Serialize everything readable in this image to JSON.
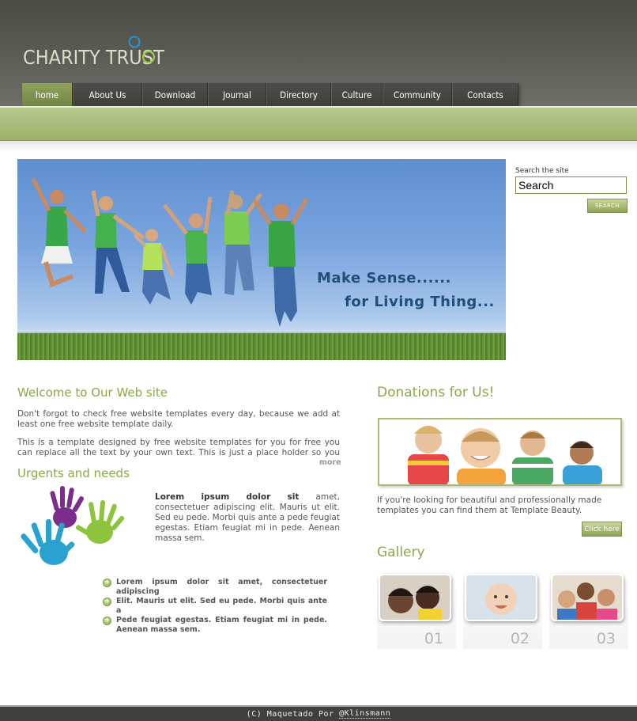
{
  "site": {
    "logo_text": "CHARITY TRUST"
  },
  "nav": {
    "items": [
      "home",
      "About Us",
      "Download",
      "Journal",
      "Directory",
      "Culture",
      "Community",
      "Contacts"
    ],
    "active": "home"
  },
  "banner": {
    "line1": "Make Sense......",
    "line2": "for Living Thing..."
  },
  "search": {
    "label": "Search the site",
    "value": "Search",
    "button": "SEARCH"
  },
  "welcome": {
    "title": "Welcome to Our Web site",
    "p1": "Don't forgot to check free website templates every day, because we add at least one free website template daily.",
    "p2": "This is a template designed by free website templates for you for free you can replace all the text by your own text. This is just a place holder so you can see how",
    "more": "more"
  },
  "urgents": {
    "title": "Urgents and needs",
    "lorem_bold": "Lorem ipsum dolor sit",
    "lorem_rest": " amet, consectetuer adipiscing elit. Mauris ut elit. Sed eu pede. Morbi quis ante a pede feugiat egestas. Etiam feugiat mi in pede. Aenean massa sem.",
    "bullets": [
      "Lorem ipsum dolor sit amet, consectetuer adipiscing",
      "Elit. Mauris ut elit. Sed eu pede. Morbi quis ante a",
      "Pede feugiat egestas. Etiam feugiat mi in pede. Aenean massa sem."
    ]
  },
  "donations": {
    "title": "Donations for Us!",
    "text": "If you're looking for beautiful and professionally made templates you can find them at Template Beauty.",
    "button": "Click here"
  },
  "gallery": {
    "title": "Gallery",
    "items": [
      "01",
      "02",
      "03"
    ]
  },
  "footer": {
    "prefix": "(C) Maquetado Por ",
    "author": "@Klinsmann"
  },
  "colors": {
    "accent_green": "#8aa84a",
    "header_dark": "#4b4c46",
    "nav_active": "#8fa15a"
  }
}
